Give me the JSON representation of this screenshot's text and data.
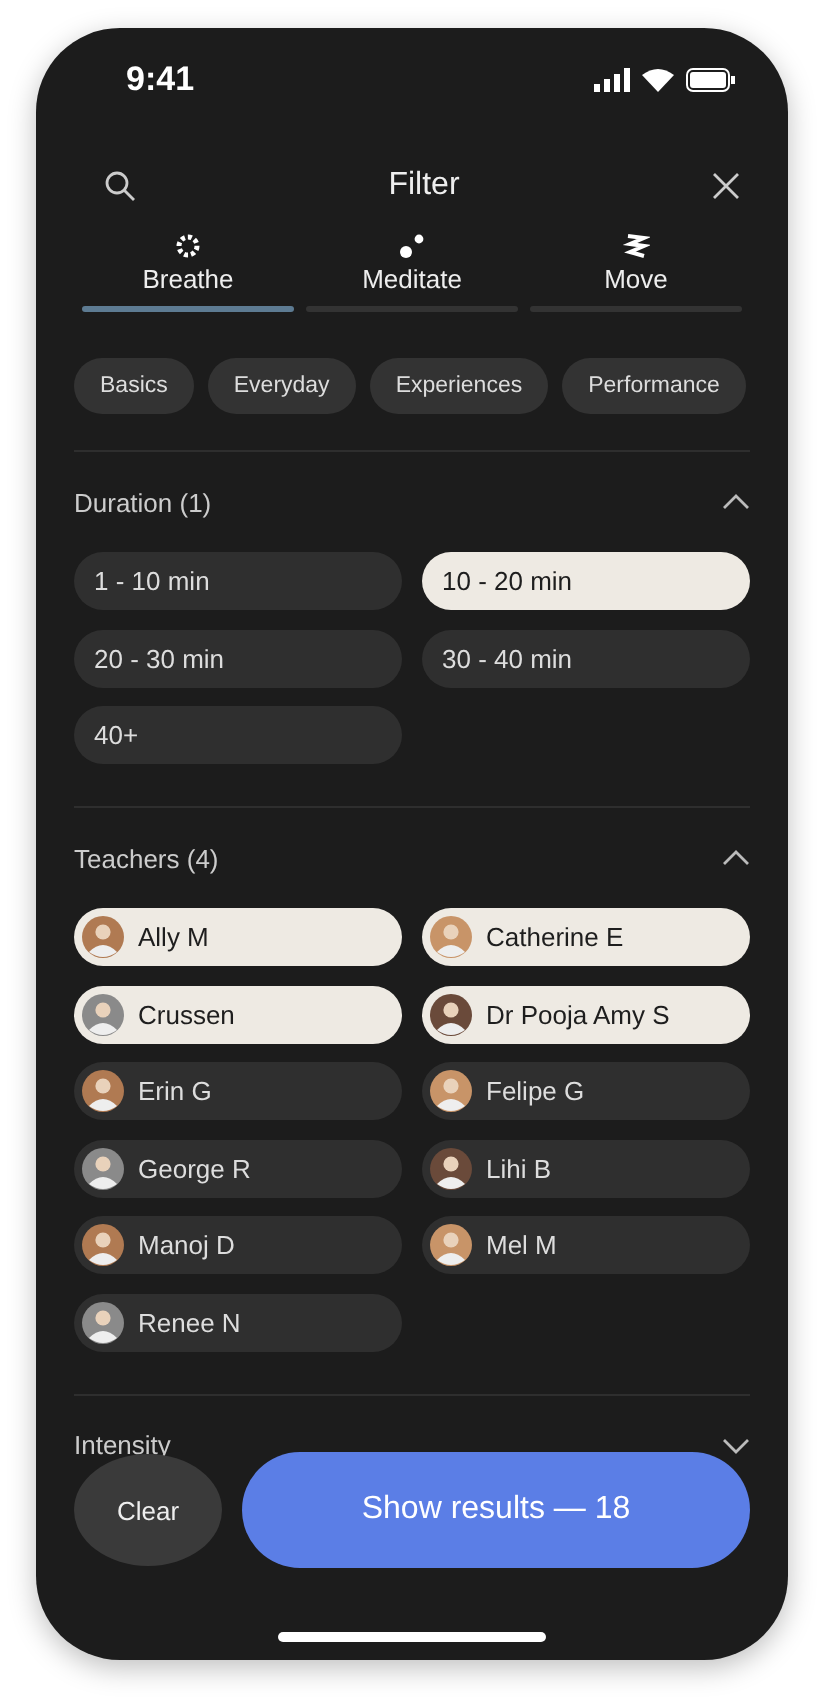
{
  "status_bar": {
    "time": "9:41"
  },
  "header": {
    "title": "Filter"
  },
  "tabs": [
    {
      "label": "Breathe",
      "kind": "gear",
      "selected": true
    },
    {
      "label": "Meditate",
      "kind": "dots",
      "selected": false
    },
    {
      "label": "Move",
      "kind": "waves",
      "selected": false
    }
  ],
  "categories": [
    {
      "label": "Basics",
      "selected": false
    },
    {
      "label": "Everyday",
      "selected": false
    },
    {
      "label": "Experiences",
      "selected": false
    },
    {
      "label": "Performance",
      "selected": false
    }
  ],
  "sections": [
    {
      "title": "Duration (1)",
      "expanded": true,
      "kind": "options",
      "options": [
        {
          "label": "1 - 10 min",
          "selected": false
        },
        {
          "label": "10 - 20 min",
          "selected": true
        },
        {
          "label": "20 - 30 min",
          "selected": false
        },
        {
          "label": "30 - 40 min",
          "selected": false
        },
        {
          "label": "40+",
          "selected": false
        }
      ]
    },
    {
      "title": "Teachers (4)",
      "expanded": true,
      "kind": "people",
      "options": [
        {
          "label": "Ally M",
          "selected": true
        },
        {
          "label": "Catherine E",
          "selected": true
        },
        {
          "label": "Crussen",
          "selected": true
        },
        {
          "label": "Dr Pooja Amy S",
          "selected": true
        },
        {
          "label": "Erin G",
          "selected": false
        },
        {
          "label": "Felipe G",
          "selected": false
        },
        {
          "label": "George R",
          "selected": false
        },
        {
          "label": "Lihi B",
          "selected": false
        },
        {
          "label": "Manoj D",
          "selected": false
        },
        {
          "label": "Mel M",
          "selected": false
        },
        {
          "label": "Renee N",
          "selected": false
        }
      ]
    },
    {
      "title": "Intensity",
      "expanded": false
    }
  ],
  "actions": {
    "clear": "Clear",
    "show": "Show results — 18"
  }
}
